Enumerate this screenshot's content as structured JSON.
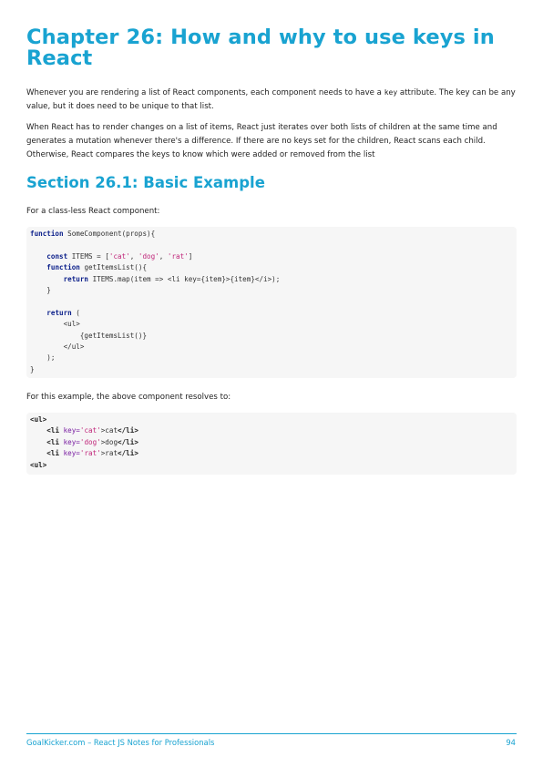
{
  "chapter": {
    "title": "Chapter 26: How and why to use keys in React"
  },
  "intro": {
    "p1_before": "Whenever you are rendering a list of React components, each component needs to have a ",
    "p1_code": "key",
    "p1_after": " attribute. The key can be any value, but it does need to be unique to that list.",
    "p2": "When React has to render changes on a list of items, React just iterates over both lists of children at the same time and generates a mutation whenever there's a difference. If there are no keys set for the children, React scans each child. Otherwise, React compares the keys to know which were added or removed from the list"
  },
  "section": {
    "title": "Section 26.1: Basic Example",
    "lead": "For a class-less React component:",
    "code1": [
      "function SomeComponent(props){",
      "",
      "    const ITEMS = ['cat', 'dog', 'rat']",
      "    function getItemsList(){",
      "        return ITEMS.map(item => <li key={item}>{item}</i>);",
      "    }",
      "",
      "    return (",
      "        <ul>",
      "            {getItemsList()}",
      "        </ul>",
      "    );",
      "}"
    ],
    "resolves_text": "For this example, the above component resolves to:",
    "code2": [
      "<ul>",
      "    <li key='cat'>cat</li>",
      "    <li key='dog'>dog</li>",
      "    <li key='rat'>rat</li>",
      "<ul>"
    ]
  },
  "footer": {
    "left": "GoalKicker.com – React JS Notes for Professionals",
    "page_number": "94"
  },
  "colors": {
    "heading": "#19a3d1",
    "code_background": "#f6f6f6",
    "keyword": "#0b1f8a",
    "string": "#c0267a"
  }
}
